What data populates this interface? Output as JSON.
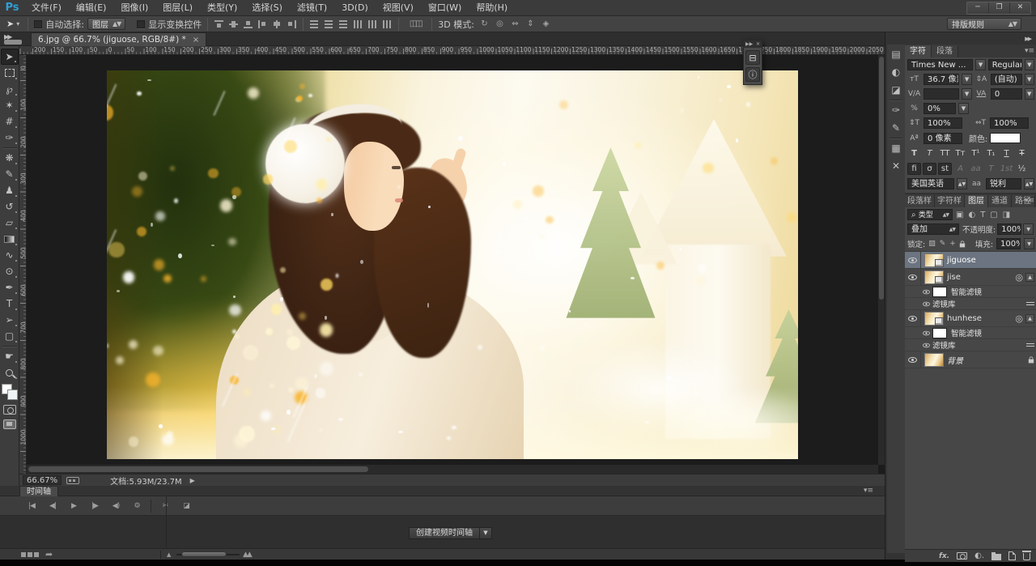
{
  "titlebar": {
    "logo": "Ps",
    "menus": [
      "文件(F)",
      "编辑(E)",
      "图像(I)",
      "图层(L)",
      "类型(Y)",
      "选择(S)",
      "滤镜(T)",
      "3D(D)",
      "视图(V)",
      "窗口(W)",
      "帮助(H)"
    ],
    "window_buttons": [
      "─",
      "❐",
      "✕"
    ]
  },
  "options": {
    "auto_select_label": "自动选择:",
    "auto_select_value": "图层",
    "show_transform_label": "显示变换控件",
    "auto_align_icon": "◫◫",
    "mode3d_label": "3D 模式:",
    "mode3d_icons": [
      {
        "name": "3d-rotate-icon",
        "glyph": "↻"
      },
      {
        "name": "3d-roll-icon",
        "glyph": "◎"
      },
      {
        "name": "3d-drag-icon",
        "glyph": "⇔"
      },
      {
        "name": "3d-slide-icon",
        "glyph": "⇕"
      },
      {
        "name": "3d-scale-icon",
        "glyph": "◈"
      }
    ],
    "align_icons": [
      "t",
      "m",
      "b",
      "l",
      "c",
      "r"
    ],
    "distribute_icons": [
      "dv",
      "dv",
      "dv",
      "dh",
      "dh",
      "dh"
    ],
    "layout_rules_value": "排版规则"
  },
  "doc_tab": {
    "title": "6.jpg @ 66.7% (jiguose, RGB/8#) *",
    "close": "×"
  },
  "ruler": {
    "h": {
      "start_value": 200,
      "step": 50,
      "max": 2100,
      "spacing": 22.9,
      "origin": 16
    },
    "v": {
      "start_value": 0,
      "step": 100,
      "max": 1000,
      "spacing": 45.8,
      "origin": 19
    }
  },
  "tools": [
    {
      "name": "move-tool",
      "glyph": "➤",
      "selected": true
    },
    {
      "name": "marquee-tool",
      "css": "css-marquee"
    },
    {
      "name": "lasso-tool",
      "glyph": "℘"
    },
    {
      "name": "magic-wand-tool",
      "glyph": "✶"
    },
    {
      "name": "crop-tool",
      "glyph": "#"
    },
    {
      "name": "eyedropper-tool",
      "glyph": "✑",
      "sep_after": true
    },
    {
      "name": "healing-brush-tool",
      "glyph": "❋"
    },
    {
      "name": "brush-tool",
      "glyph": "✎"
    },
    {
      "name": "clone-stamp-tool",
      "glyph": "♟"
    },
    {
      "name": "history-brush-tool",
      "glyph": "↺"
    },
    {
      "name": "eraser-tool",
      "glyph": "▱"
    },
    {
      "name": "gradient-tool",
      "css": "css-grad"
    },
    {
      "name": "smudge-tool",
      "glyph": "∿"
    },
    {
      "name": "dodge-tool",
      "glyph": "⊙"
    },
    {
      "name": "pen-tool",
      "glyph": "✒"
    },
    {
      "name": "type-tool",
      "glyph": "T"
    },
    {
      "name": "path-select-tool",
      "glyph": "➢"
    },
    {
      "name": "shape-tool",
      "glyph": "▢",
      "sep_after": true
    },
    {
      "name": "hand-tool",
      "glyph": "☛"
    },
    {
      "name": "zoom-tool",
      "css": "css-zoom"
    }
  ],
  "float_panel": {
    "icons": [
      {
        "name": "properties-panel-icon",
        "glyph": "⊟"
      },
      {
        "name": "info-panel-icon",
        "glyph": "ⓘ"
      }
    ]
  },
  "dock_icons": [
    {
      "name": "history-panel-icon",
      "glyph": "▤"
    },
    {
      "name": "adjustments-panel-icon",
      "glyph": "◐"
    },
    {
      "name": "styles-panel-icon",
      "glyph": "◪",
      "sep_after": true
    },
    {
      "name": "brush-panel-icon",
      "glyph": "✑"
    },
    {
      "name": "brush-presets-panel-icon",
      "glyph": "✎",
      "sep_after": true
    },
    {
      "name": "swatches-panel-icon",
      "glyph": "▦"
    },
    {
      "name": "tool-presets-panel-icon",
      "glyph": "✕"
    }
  ],
  "char_panel": {
    "tabs": [
      "字符",
      "段落"
    ],
    "font_family": "Times New ...",
    "font_style": "Regular",
    "size_value": "36.7 像素",
    "leading_value": "(自动)",
    "kerning_value": "",
    "tracking_value": "0",
    "proportion_value": "0%",
    "vscale_value": "100%",
    "hscale_value": "100%",
    "baseline_value": "0 像素",
    "color_label": "颜色:",
    "t_row": [
      "T",
      "T",
      "TT",
      "Tт",
      "T¹",
      "T₁",
      "T",
      "Ŧ"
    ],
    "ot_row": [
      "fi",
      "σ",
      "st",
      "A",
      "aa",
      "T",
      "1st",
      "½"
    ],
    "language": "美国英语",
    "aa_icon": "aa",
    "antialias": "锐利"
  },
  "layers_panel": {
    "tabs": [
      "段落样",
      "字符样",
      "图层",
      "通道",
      "路径"
    ],
    "filter_label": "类型",
    "filter_icons": [
      "▣",
      "◐",
      "T",
      "▢",
      "◨"
    ],
    "blend_mode": "叠加",
    "opacity_label": "不透明度:",
    "opacity": "100%",
    "lock_label": "锁定:",
    "lock_icons": [
      "▨",
      "✎",
      "+"
    ],
    "fill_label": "填充:",
    "fill": "100%",
    "layers": [
      {
        "name": "jiguose",
        "selected": true,
        "smart": true
      },
      {
        "name": "jise",
        "smart": true,
        "badge": true,
        "children": [
          {
            "label": "智能滤镜",
            "mask": true
          },
          {
            "label": "滤镜库",
            "fxopt": true
          }
        ]
      },
      {
        "name": "hunhese",
        "smart": true,
        "badge": true,
        "children": [
          {
            "label": "智能滤镜",
            "mask": true
          },
          {
            "label": "滤镜库",
            "fxopt": true
          }
        ]
      },
      {
        "name": "背景",
        "background": true,
        "locked": true
      }
    ]
  },
  "status": {
    "zoom": "66.67%",
    "doc_label": "文档:5.93M/23.7M",
    "arrow": "▶"
  },
  "timeline": {
    "tab": "时间轴",
    "transport": [
      {
        "name": "go-first-frame-button",
        "glyph": "|◀"
      },
      {
        "name": "prev-frame-button",
        "glyph": "◀|"
      },
      {
        "name": "play-button",
        "glyph": "▶"
      },
      {
        "name": "next-frame-button",
        "glyph": "|▶"
      },
      {
        "name": "mute-audio-button",
        "glyph": "◀)"
      },
      {
        "name": "timeline-settings-button",
        "glyph": "⚙",
        "sep_after": true
      },
      {
        "name": "split-clip-button",
        "glyph": "✂"
      },
      {
        "name": "transition-button",
        "glyph": "◪"
      }
    ],
    "create_button": "创建视频时间轴",
    "render_arrow": "➦"
  }
}
